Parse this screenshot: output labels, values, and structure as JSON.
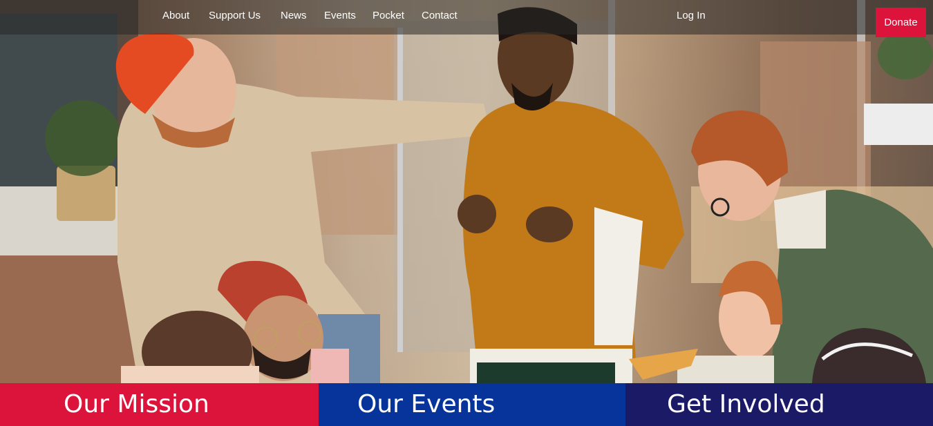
{
  "nav": {
    "links": [
      "About",
      "Support Us",
      "News",
      "Events",
      "Pocket",
      "Contact"
    ],
    "login": "Log In",
    "donate": "Donate"
  },
  "cards": {
    "mission": "Our Mission",
    "events": "Our Events",
    "involved": "Get Involved"
  },
  "colors": {
    "brand_red": "#dc143c",
    "brand_blue": "#06349a",
    "brand_navy": "#1a1a66"
  },
  "hero": {
    "image_icon": "group-of-friends-photo"
  }
}
